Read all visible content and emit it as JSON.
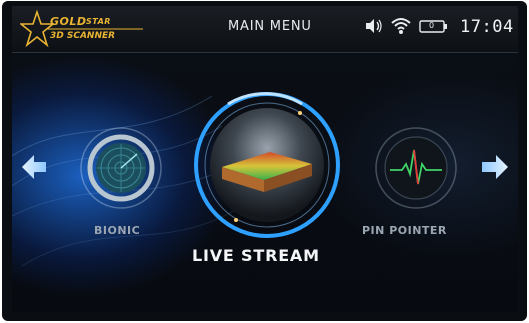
{
  "header": {
    "logo_line1": "GOLD",
    "logo_line1b": "STAR",
    "logo_line2": "3D SCANNER",
    "title": "MAIN MENU",
    "time": "17:04",
    "battery_text": "0"
  },
  "menu": {
    "left_label": "BIONIC",
    "center_label": "LIVE STREAM",
    "right_label": "PIN POINTER"
  },
  "icons": {
    "volume": "speaker-icon",
    "wifi": "wifi-icon",
    "battery": "battery-icon",
    "prev": "arrow-left-icon",
    "next": "arrow-right-icon"
  },
  "colors": {
    "accent": "#2ea0ff",
    "logo_gold": "#e8b432"
  }
}
